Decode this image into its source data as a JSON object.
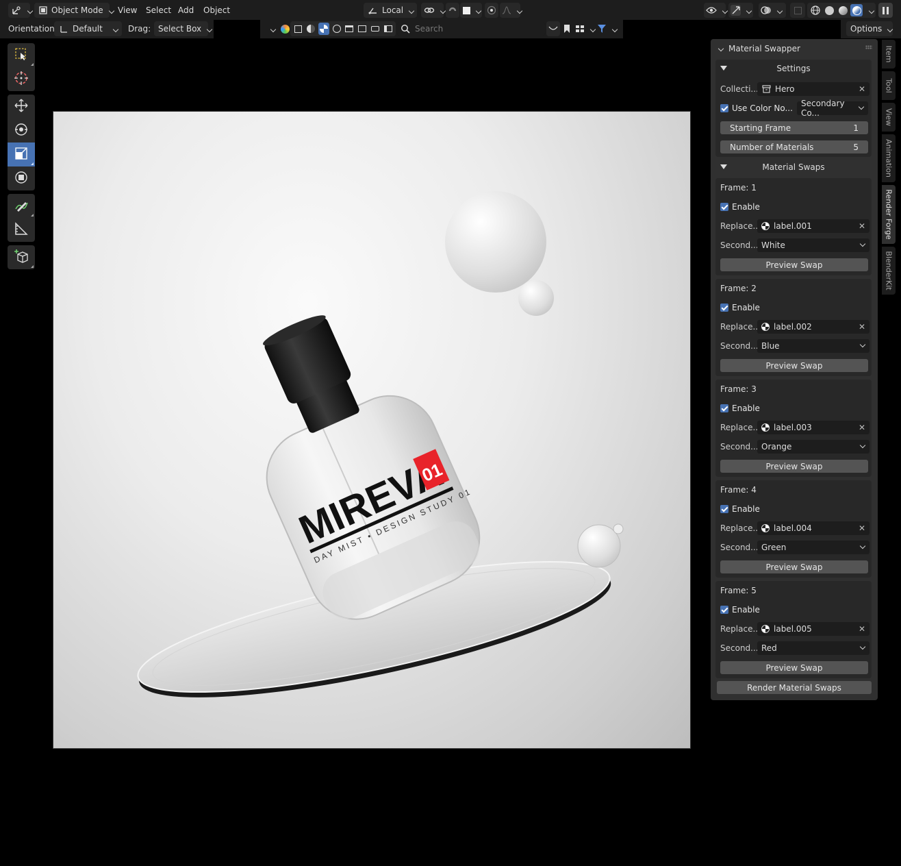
{
  "header": {
    "mode": "Object Mode",
    "menus": [
      "View",
      "Select",
      "Add",
      "Object"
    ],
    "transform_space": "Local",
    "orientation_label": "Orientation:",
    "orientation_value": "Default",
    "drag_label": "Drag:",
    "drag_value": "Select Box",
    "search_placeholder": "Search",
    "options_label": "Options"
  },
  "panel": {
    "title": "Material Swapper",
    "settings": {
      "heading": "Settings",
      "collection_label": "Collecti...",
      "collection_value": "Hero",
      "use_color_label": "Use Color No...",
      "use_color_dropdown": "Secondary Co...",
      "starting_frame_label": "Starting Frame",
      "starting_frame_value": "1",
      "num_materials_label": "Number of Materials",
      "num_materials_value": "5"
    },
    "swaps_heading": "Material Swaps",
    "swaps": [
      {
        "frame": "Frame: 1",
        "enable": "Enable",
        "replace_label": "Replace...",
        "material": "label.001",
        "second_label": "Second...",
        "color": "White",
        "button": "Preview Swap"
      },
      {
        "frame": "Frame: 2",
        "enable": "Enable",
        "replace_label": "Replace...",
        "material": "label.002",
        "second_label": "Second...",
        "color": "Blue",
        "button": "Preview Swap"
      },
      {
        "frame": "Frame: 3",
        "enable": "Enable",
        "replace_label": "Replace...",
        "material": "label.003",
        "second_label": "Second...",
        "color": "Orange",
        "button": "Preview Swap"
      },
      {
        "frame": "Frame: 4",
        "enable": "Enable",
        "replace_label": "Replace...",
        "material": "label.004",
        "second_label": "Second...",
        "color": "Green",
        "button": "Preview Swap"
      },
      {
        "frame": "Frame: 5",
        "enable": "Enable",
        "replace_label": "Replace...",
        "material": "label.005",
        "second_label": "Second...",
        "color": "Red",
        "button": "Preview Swap"
      }
    ],
    "render_button": "Render Material Swaps"
  },
  "side_tabs": [
    "Item",
    "Tool",
    "View",
    "Animation",
    "Render Forge",
    "BlenderKit"
  ],
  "render": {
    "brand": "MIREVA",
    "number": "01",
    "tagline": "DAY MIST • DESIGN STUDY 01"
  },
  "colors": {
    "accent": "#4772b3",
    "panel": "#303030",
    "header": "#1d1d1d",
    "label_red": "#e8232a"
  }
}
